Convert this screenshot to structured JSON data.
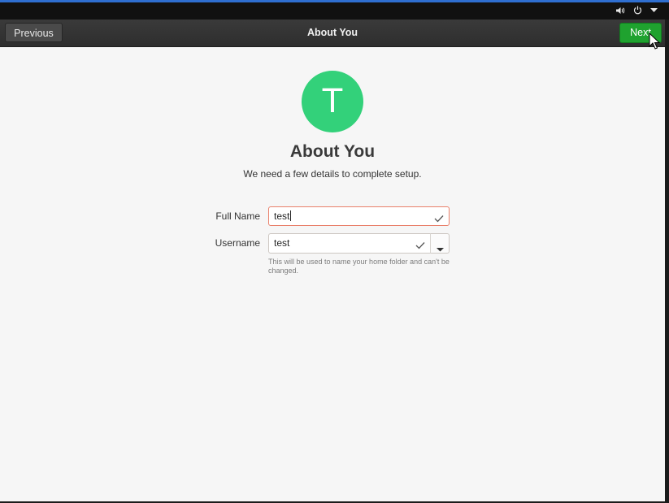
{
  "system_tray": {
    "icons": [
      "volume-icon",
      "power-icon",
      "dropdown-arrow-icon"
    ]
  },
  "header": {
    "previous_label": "Previous",
    "title": "About You",
    "next_label": "Next"
  },
  "avatar": {
    "initial": "T",
    "color": "#33d17a"
  },
  "page": {
    "heading": "About You",
    "subtitle": "We need a few details to complete setup."
  },
  "form": {
    "full_name": {
      "label": "Full Name",
      "value": "test",
      "valid": true
    },
    "username": {
      "label": "Username",
      "value": "test",
      "valid": true,
      "hint": "This will be used to name your home folder and can't be changed."
    }
  },
  "colors": {
    "accent_top_line": "#2f6fd1",
    "next_button": "#1fa22f",
    "avatar": "#33d17a",
    "focused_field_border": "#e9806a"
  }
}
